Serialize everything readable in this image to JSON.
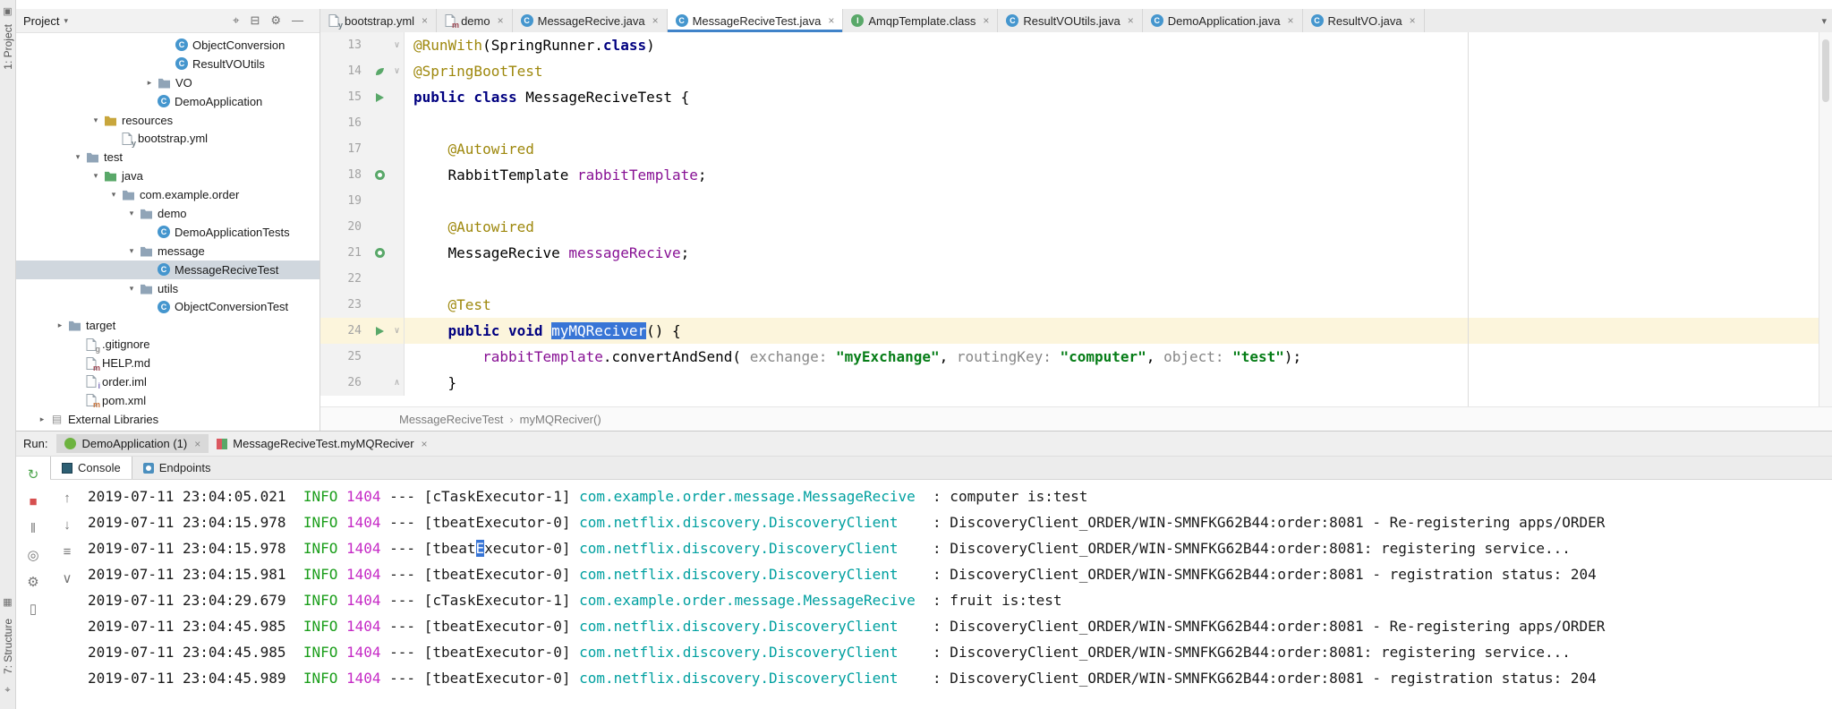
{
  "colors": {
    "accent_blue": "#4083c9",
    "selection_blue": "#3875d6",
    "current_line": "#fcf5dc",
    "keyword": "#000080",
    "annotation": "#9e880d",
    "string_green": "#067d17",
    "field_purple": "#871094",
    "console_info": "#1b9e1b",
    "console_pid": "#c62bc6",
    "console_logger": "#00a0a0",
    "run_green": "#59a869",
    "stop_red": "#d64f4f",
    "tree_selection": "#d0d7de"
  },
  "activity_bar": {
    "top": {
      "tool_icon_glyph": "▣",
      "project_label": "1: Project"
    },
    "bottom": {
      "grid_glyph": "▦",
      "structure_label": "7: Structure",
      "pin_glyph": "⌖"
    }
  },
  "project_panel": {
    "header": {
      "title": "Project",
      "caret_glyph": "▾",
      "icons": [
        {
          "name": "locate-file-icon",
          "glyph": "⌖"
        },
        {
          "name": "collapse-all-icon",
          "glyph": "⊟"
        },
        {
          "name": "settings-gear-icon",
          "glyph": "⚙"
        },
        {
          "name": "hide-panel-icon",
          "glyph": "—"
        }
      ]
    },
    "tree": [
      {
        "label": "ObjectConversion",
        "level": 7,
        "icon": "class"
      },
      {
        "label": "ResultVOUtils",
        "level": 7,
        "icon": "class"
      },
      {
        "label": "VO",
        "level": 6,
        "icon": "folder",
        "chevron": "closed"
      },
      {
        "label": "DemoApplication",
        "level": 6,
        "icon": "class"
      },
      {
        "label": "resources",
        "level": 3,
        "icon": "folder-gold",
        "chevron": "open"
      },
      {
        "label": "bootstrap.yml",
        "level": 4,
        "icon": "yml"
      },
      {
        "label": "test",
        "level": 2,
        "icon": "folder",
        "chevron": "open"
      },
      {
        "label": "java",
        "level": 3,
        "icon": "folder-green",
        "chevron": "open"
      },
      {
        "label": "com.example.order",
        "level": 4,
        "icon": "folder",
        "chevron": "open"
      },
      {
        "label": "demo",
        "level": 5,
        "icon": "folder",
        "chevron": "open"
      },
      {
        "label": "DemoApplicationTests",
        "level": 6,
        "icon": "class"
      },
      {
        "label": "message",
        "level": 5,
        "icon": "folder",
        "chevron": "open"
      },
      {
        "label": "MessageReciveTest",
        "level": 6,
        "icon": "class",
        "selected": true
      },
      {
        "label": "utils",
        "level": 5,
        "icon": "folder",
        "chevron": "open"
      },
      {
        "label": "ObjectConversionTest",
        "level": 6,
        "icon": "class"
      },
      {
        "label": "target",
        "level": 1,
        "icon": "folder",
        "chevron": "closed"
      },
      {
        "label": ".gitignore",
        "level": 2,
        "icon": "git"
      },
      {
        "label": "HELP.md",
        "level": 2,
        "icon": "md"
      },
      {
        "label": "order.iml",
        "level": 2,
        "icon": "iml"
      },
      {
        "label": "pom.xml",
        "level": 2,
        "icon": "xml"
      },
      {
        "label": "External Libraries",
        "level": 0,
        "icon": "lib",
        "chevron": "closed"
      }
    ]
  },
  "editor": {
    "tabbar_overflow_glyph": "▾",
    "tabs": [
      {
        "label": "bootstrap.yml",
        "icon": "yml",
        "close": "×"
      },
      {
        "label": "demo",
        "icon": "md",
        "close": "×"
      },
      {
        "label": "MessageRecive.java",
        "icon": "class",
        "close": "×"
      },
      {
        "label": "MessageReciveTest.java",
        "icon": "class",
        "close": "×",
        "active": true
      },
      {
        "label": "AmqpTemplate.class",
        "icon": "interface",
        "close": "×"
      },
      {
        "label": "ResultVOUtils.java",
        "icon": "class",
        "close": "×"
      },
      {
        "label": "DemoApplication.java",
        "icon": "class",
        "close": "×"
      },
      {
        "label": "ResultVO.java",
        "icon": "class",
        "close": "×"
      }
    ],
    "breadcrumb": {
      "0": "MessageReciveTest",
      "separator": "›",
      "1": "myMQReciver()"
    },
    "lines": [
      {
        "num": 13,
        "fold": "v",
        "segments": [
          {
            "k": "ann",
            "t": "@RunWith"
          },
          {
            "k": "pln",
            "t": "(SpringRunner."
          },
          {
            "k": "kw",
            "t": "class"
          },
          {
            "k": "pln",
            "t": ")"
          }
        ]
      },
      {
        "num": 14,
        "gutter": "leaf",
        "fold": "v",
        "segments": [
          {
            "k": "ann",
            "t": "@SpringBootTest"
          }
        ]
      },
      {
        "num": 15,
        "gutter": "run",
        "segments": [
          {
            "k": "kw",
            "t": "public class "
          },
          {
            "k": "pln",
            "t": "MessageReciveTest {"
          }
        ]
      },
      {
        "num": 16,
        "segments": []
      },
      {
        "num": 17,
        "segments": [
          {
            "k": "pln",
            "t": "    "
          },
          {
            "k": "ann",
            "t": "@Autowired"
          }
        ]
      },
      {
        "num": 18,
        "gutter": "bean",
        "segments": [
          {
            "k": "pln",
            "t": "    RabbitTemplate "
          },
          {
            "k": "fld",
            "t": "rabbitTemplate"
          },
          {
            "k": "pln",
            "t": ";"
          }
        ]
      },
      {
        "num": 19,
        "segments": []
      },
      {
        "num": 20,
        "segments": [
          {
            "k": "pln",
            "t": "    "
          },
          {
            "k": "ann",
            "t": "@Autowired"
          }
        ]
      },
      {
        "num": 21,
        "gutter": "bean",
        "segments": [
          {
            "k": "pln",
            "t": "    MessageRecive "
          },
          {
            "k": "fld",
            "t": "messageRecive"
          },
          {
            "k": "pln",
            "t": ";"
          }
        ]
      },
      {
        "num": 22,
        "segments": []
      },
      {
        "num": 23,
        "segments": [
          {
            "k": "pln",
            "t": "    "
          },
          {
            "k": "ann",
            "t": "@Test"
          }
        ]
      },
      {
        "num": 24,
        "gutter": "run",
        "fold": "v",
        "current": true,
        "segments": [
          {
            "k": "kw",
            "t": "    public void "
          },
          {
            "k": "sel",
            "t": "myMQReciver"
          },
          {
            "k": "pln",
            "t": "() {"
          }
        ]
      },
      {
        "num": 25,
        "segments": [
          {
            "k": "pln",
            "t": "        "
          },
          {
            "k": "fld",
            "t": "rabbitTemplate"
          },
          {
            "k": "pln",
            "t": ".convertAndSend( "
          },
          {
            "k": "hint",
            "t": "exchange: "
          },
          {
            "k": "str",
            "t": "\"myExchange\""
          },
          {
            "k": "pln",
            "t": ", "
          },
          {
            "k": "hint",
            "t": "routingKey: "
          },
          {
            "k": "str",
            "t": "\"computer\""
          },
          {
            "k": "pln",
            "t": ", "
          },
          {
            "k": "hint",
            "t": "object: "
          },
          {
            "k": "str",
            "t": "\"test\""
          },
          {
            "k": "pln",
            "t": ");"
          }
        ]
      },
      {
        "num": 26,
        "fold": "^",
        "segments": [
          {
            "k": "pln",
            "t": "    }"
          }
        ]
      }
    ]
  },
  "run_panel": {
    "label": "Run:",
    "run_tabs": [
      {
        "label": "DemoApplication (1)",
        "icon": "spring",
        "close": "×",
        "active": true
      },
      {
        "label": "MessageReciveTest.myMQReciver",
        "icon": "junit",
        "close": "×"
      }
    ],
    "view_tabs": [
      {
        "label": "Console",
        "icon": "console",
        "active": true
      },
      {
        "label": "Endpoints",
        "icon": "endpoints"
      }
    ],
    "toolbar_left": [
      {
        "name": "rerun-icon",
        "glyph": "↻",
        "color": "#4da54d"
      },
      {
        "name": "stop-icon",
        "glyph": "■",
        "color": "#d64f4f"
      },
      {
        "name": "pause-output-icon",
        "glyph": "‖",
        "color": "#777777"
      },
      {
        "name": "thread-dump-icon",
        "glyph": "◎",
        "color": "#777777"
      },
      {
        "name": "settings-gear-icon",
        "glyph": "⚙",
        "color": "#777777"
      },
      {
        "name": "trash-gc-icon",
        "glyph": "▯",
        "color": "#777777"
      }
    ],
    "toolbar_inner": [
      {
        "name": "up-stack-icon",
        "glyph": "↑",
        "color": "#777777"
      },
      {
        "name": "down-stack-icon",
        "glyph": "↓",
        "color": "#777777"
      },
      {
        "name": "soft-wrap-icon",
        "glyph": "≡",
        "color": "#777777"
      },
      {
        "name": "scroll-to-end-icon",
        "glyph": "∨",
        "color": "#777777"
      }
    ],
    "console_lines": [
      {
        "segments": [
          {
            "k": "pln",
            "t": "2019-07-11 23:04:05.021"
          },
          {
            "k": "info",
            "t": "  INFO"
          },
          {
            "k": "pid",
            "t": " 1404"
          },
          {
            "k": "pln",
            "t": " --- [cTaskExecutor-1] "
          },
          {
            "k": "logger",
            "t": "com.example.order.message.MessageRecive "
          },
          {
            "k": "pln",
            "t": " : computer is:test"
          }
        ]
      },
      {
        "segments": [
          {
            "k": "pln",
            "t": "2019-07-11 23:04:15.978"
          },
          {
            "k": "info",
            "t": "  INFO"
          },
          {
            "k": "pid",
            "t": " 1404"
          },
          {
            "k": "pln",
            "t": " --- [tbeatExecutor-0] "
          },
          {
            "k": "logger",
            "t": "com.netflix.discovery.DiscoveryClient   "
          },
          {
            "k": "pln",
            "t": " : DiscoveryClient_ORDER/WIN-SMNFKG62B44:order:8081 - Re-registering apps/ORDER"
          }
        ]
      },
      {
        "segments": [
          {
            "k": "pln",
            "t": "2019-07-11 23:04:15.978"
          },
          {
            "k": "info",
            "t": "  INFO"
          },
          {
            "k": "pid",
            "t": " 1404"
          },
          {
            "k": "pln",
            "t": " --- [tbeat"
          },
          {
            "k": "sel",
            "t": "E"
          },
          {
            "k": "pln",
            "t": "xecutor-0] "
          },
          {
            "k": "logger",
            "t": "com.netflix.discovery.DiscoveryClient   "
          },
          {
            "k": "pln",
            "t": " : DiscoveryClient_ORDER/WIN-SMNFKG62B44:order:8081: registering service..."
          }
        ]
      },
      {
        "segments": [
          {
            "k": "pln",
            "t": "2019-07-11 23:04:15.981"
          },
          {
            "k": "info",
            "t": "  INFO"
          },
          {
            "k": "pid",
            "t": " 1404"
          },
          {
            "k": "pln",
            "t": " --- [tbeatExecutor-0] "
          },
          {
            "k": "logger",
            "t": "com.netflix.discovery.DiscoveryClient   "
          },
          {
            "k": "pln",
            "t": " : DiscoveryClient_ORDER/WIN-SMNFKG62B44:order:8081 - registration status: 204"
          }
        ]
      },
      {
        "segments": [
          {
            "k": "pln",
            "t": "2019-07-11 23:04:29.679"
          },
          {
            "k": "info",
            "t": "  INFO"
          },
          {
            "k": "pid",
            "t": " 1404"
          },
          {
            "k": "pln",
            "t": " --- [cTaskExecutor-1] "
          },
          {
            "k": "logger",
            "t": "com.example.order.message.MessageRecive "
          },
          {
            "k": "pln",
            "t": " : fruit is:test"
          }
        ]
      },
      {
        "segments": [
          {
            "k": "pln",
            "t": "2019-07-11 23:04:45.985"
          },
          {
            "k": "info",
            "t": "  INFO"
          },
          {
            "k": "pid",
            "t": " 1404"
          },
          {
            "k": "pln",
            "t": " --- [tbeatExecutor-0] "
          },
          {
            "k": "logger",
            "t": "com.netflix.discovery.DiscoveryClient   "
          },
          {
            "k": "pln",
            "t": " : DiscoveryClient_ORDER/WIN-SMNFKG62B44:order:8081 - Re-registering apps/ORDER"
          }
        ]
      },
      {
        "segments": [
          {
            "k": "pln",
            "t": "2019-07-11 23:04:45.985"
          },
          {
            "k": "info",
            "t": "  INFO"
          },
          {
            "k": "pid",
            "t": " 1404"
          },
          {
            "k": "pln",
            "t": " --- [tbeatExecutor-0] "
          },
          {
            "k": "logger",
            "t": "com.netflix.discovery.DiscoveryClient   "
          },
          {
            "k": "pln",
            "t": " : DiscoveryClient_ORDER/WIN-SMNFKG62B44:order:8081: registering service..."
          }
        ]
      },
      {
        "segments": [
          {
            "k": "pln",
            "t": "2019-07-11 23:04:45.989"
          },
          {
            "k": "info",
            "t": "  INFO"
          },
          {
            "k": "pid",
            "t": " 1404"
          },
          {
            "k": "pln",
            "t": " --- [tbeatExecutor-0] "
          },
          {
            "k": "logger",
            "t": "com.netflix.discovery.DiscoveryClient   "
          },
          {
            "k": "pln",
            "t": " : DiscoveryClient_ORDER/WIN-SMNFKG62B44:order:8081 - registration status: 204"
          }
        ]
      }
    ]
  }
}
